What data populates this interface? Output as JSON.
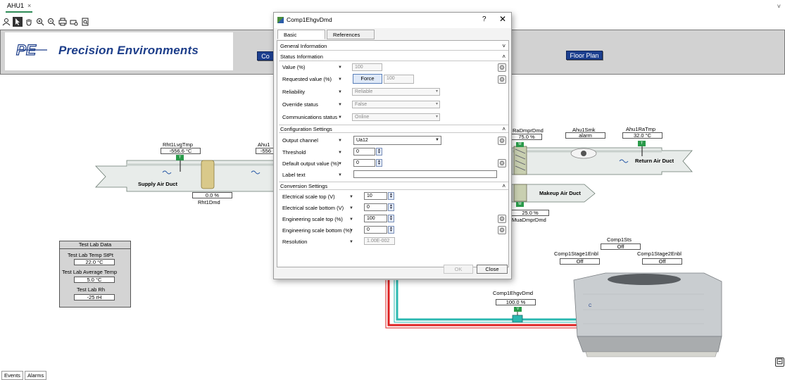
{
  "tab": {
    "label": "AHU1",
    "close": "×"
  },
  "window": {
    "chevron": "˅"
  },
  "toolbar": [
    "user-icon",
    "pointer-icon",
    "pan-hand-icon",
    "zoom-in-icon",
    "zoom-out-icon",
    "print-icon",
    "print-setup-icon",
    "print-preview-icon"
  ],
  "banner": {
    "logo_mark": "PE",
    "logo_text": "Precision Environments",
    "btn_left": "Co",
    "btn_floorplan": "Floor Plan"
  },
  "graphic": {
    "rht1lvgtmp_label": "Rht1LvgTmp",
    "rht1lvgtmp_value": "-556.6 °C",
    "ahu1_label": "Ahu1",
    "ahu1_value": "-556",
    "supply_air_duct": "Supply Air Duct",
    "rht1dmd_value": "0.0 %",
    "rht1dmd_label": "Rht1Dmd",
    "radmprdmd_label": "RaDmprDmd",
    "radmprdmd_value": "75.0 %",
    "ahu1smk_label": "Ahu1Smk",
    "ahu1smk_value": "alarm",
    "ahu1ratmp_label": "Ahu1RaTmp",
    "ahu1ratmp_value": "32.0 °C",
    "return_air_duct": "Return Air Duct",
    "makeup_air_duct": "Makeup Air Duct",
    "muadmprdmd_value": "25.0 %",
    "muadmprdmd_label": "MuaDmprDmd",
    "comp1sts_label": "Comp1Sts",
    "comp1sts_value": "Off",
    "comp1stage1enbl_label": "Comp1Stage1Enbl",
    "comp1stage1enbl_value": "Off",
    "comp1stage2enbl_label": "Comp1Stage2Enbl",
    "comp1stage2enbl_value": "Off",
    "comp1ehgvdmd_label": "Comp1EhgvDmd",
    "comp1ehgvdmd_value": "100.0 %",
    "tag_t": "T",
    "tag_m": "M",
    "tag_v": "V"
  },
  "testlab": {
    "title": "Test Lab Data",
    "temp_stpt_label": "Test Lab Temp StPt",
    "temp_stpt_value": "22.0 °C",
    "avg_temp_label": "Test Lab Average Temp",
    "avg_temp_value": "5.0 °C",
    "rh_label": "Test Lab Rh",
    "rh_value": "-25 rH"
  },
  "bottom_tabs": {
    "events": "Events",
    "alarms": "Alarms"
  },
  "dialog": {
    "title": "Comp1EhgvDmd",
    "help": "?",
    "close_x": "✕",
    "tabs": {
      "basic": "Basic",
      "references": "References"
    },
    "sections": {
      "general": "General Information",
      "status": "Status Information",
      "config": "Configuration Settings",
      "conversion": "Conversion Settings"
    },
    "status_rows": {
      "value_label": "Value (%)",
      "value": "100",
      "requested_label": "Requested value (%)",
      "force": "Force",
      "requested": "100",
      "reliability_label": "Reliability",
      "reliability": "Reliable",
      "override_label": "Override status",
      "override": "False",
      "comm_label": "Communications status",
      "comm": "Online"
    },
    "config_rows": {
      "output_channel_label": "Output channel",
      "output_channel": "Ua12",
      "threshold_label": "Threshold",
      "threshold": "0",
      "default_output_label": "Default output value (%)",
      "default_output": "0",
      "label_text_label": "Label text",
      "label_text": ""
    },
    "conversion_rows": {
      "elec_top_label": "Electrical scale top (V)",
      "elec_top": "10",
      "elec_bottom_label": "Electrical scale bottom (V)",
      "elec_bottom": "0",
      "eng_top_label": "Engineering scale top (%)",
      "eng_top": "100",
      "eng_bottom_label": "Engineering scale bottom (%)",
      "eng_bottom": "0",
      "resolution_label": "Resolution",
      "resolution": "1.00E-002"
    },
    "buttons": {
      "ok": "OK",
      "close": "Close"
    }
  }
}
